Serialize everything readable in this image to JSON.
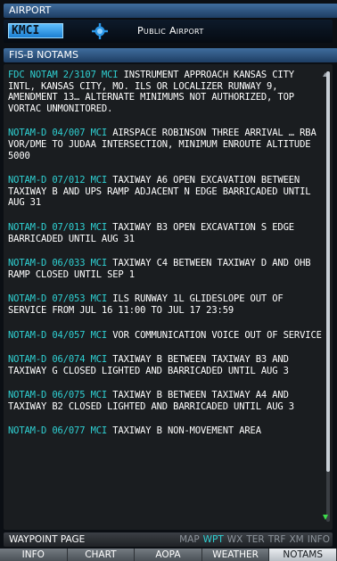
{
  "airport_header": {
    "label": "AIRPORT"
  },
  "airport": {
    "ident": "KMCI",
    "type": "Public Airport"
  },
  "notams_header": {
    "label": "FIS-B NOTAMS"
  },
  "notams": [
    {
      "prefix": "FDC NOTAM 2/3107 MCI",
      "text": " INSTRUMENT APPROACH KANSAS CITY INTL, KANSAS CITY, MO. ILS OR LOCALIZER RUNWAY 9, AMENDMENT 13… ALTERNATE MINIMUMS NOT AUTHORIZED, TOP VORTAC UNMONITORED."
    },
    {
      "prefix": "NOTAM-D 04/007 MCI",
      "text": " AIRSPACE ROBINSON THREE ARRIVAL … RBA VOR/DME TO JUDAA INTERSECTION, MINIMUM ENROUTE ALTITUDE 5000"
    },
    {
      "prefix": "NOTAM-D 07/012 MCI",
      "text": " TAXIWAY A6 OPEN EXCAVATION BETWEEN TAXIWAY B AND UPS RAMP ADJACENT N EDGE BARRICADED UNTIL AUG 31"
    },
    {
      "prefix": "NOTAM-D 07/013 MCI",
      "text": " TAXIWAY B3 OPEN EXCAVATION S EDGE BARRICADED UNTIL AUG 31"
    },
    {
      "prefix": "NOTAM-D 06/033 MCI",
      "text": " TAXIWAY C4 BETWEEN TAXIWAY D AND OHB RAMP CLOSED UNTIL SEP 1"
    },
    {
      "prefix": "NOTAM-D 07/053 MCI",
      "text": " ILS RUNWAY 1L GLIDESLOPE OUT OF SERVICE FROM JUL 16 11:00 TO JUL 17 23:59"
    },
    {
      "prefix": "NOTAM-D 04/057 MCI",
      "text": " VOR COMMUNICATION VOICE OUT OF SERVICE"
    },
    {
      "prefix": "NOTAM-D 06/074 MCI",
      "text": " TAXIWAY B BETWEEN TAXIWAY B3 AND TAXIWAY G CLOSED LIGHTED AND BARRICADED UNTIL AUG 3"
    },
    {
      "prefix": "NOTAM-D 06/075 MCI",
      "text": " TAXIWAY B BETWEEN TAXIWAY A4 AND TAXIWAY B2 CLOSED LIGHTED AND BARRICADED UNTIL AUG 3"
    },
    {
      "prefix": "NOTAM-D 06/077 MCI",
      "text": " TAXIWAY B NON-MOVEMENT AREA"
    }
  ],
  "scroll": {
    "position": 0.0,
    "visible_fraction": 0.89
  },
  "footer": {
    "page": "WAYPOINT PAGE",
    "groups": [
      "MAP",
      "WPT",
      "WX",
      "TER",
      "TRF",
      "XM",
      "INFO"
    ],
    "active_group": "WPT"
  },
  "softkeys": [
    {
      "label": "INFO",
      "active": false
    },
    {
      "label": "CHART",
      "active": false
    },
    {
      "label": "AOPA",
      "active": false
    },
    {
      "label": "WEATHER",
      "active": false
    },
    {
      "label": "NOTAMS",
      "active": true
    }
  ],
  "colors": {
    "highlight": "#2fd0d2",
    "ident_bg": "#2b97e8",
    "header": "#2f5a88"
  }
}
